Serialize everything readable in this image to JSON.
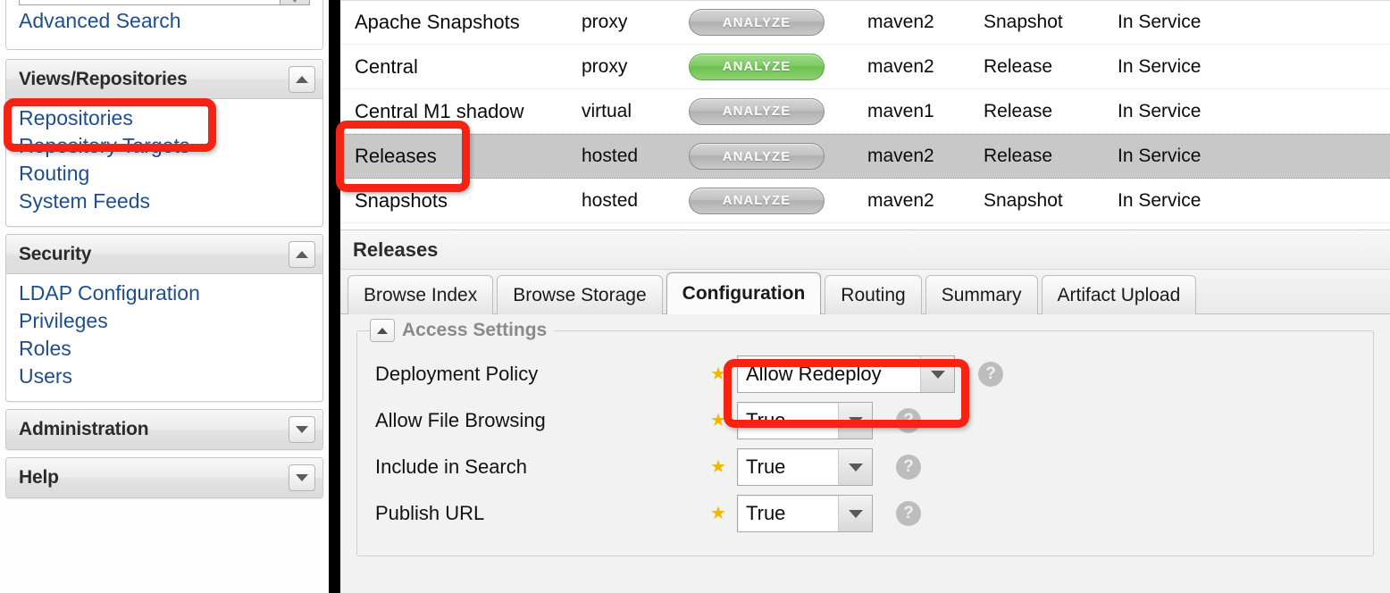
{
  "sidebar": {
    "search": {
      "value": "",
      "placeholder": "",
      "go_icon": "chevron-down-icon",
      "advanced_search_label": "Advanced Search"
    },
    "panels": [
      {
        "title": "Views/Repositories",
        "collapse_icon": "triangle-up-icon",
        "expanded": true,
        "items": [
          {
            "label": "Repositories",
            "selected": true
          },
          {
            "label": "Repository Targets",
            "selected": false
          },
          {
            "label": "Routing",
            "selected": false
          },
          {
            "label": "System Feeds",
            "selected": false
          }
        ]
      },
      {
        "title": "Security",
        "collapse_icon": "triangle-up-icon",
        "expanded": true,
        "items": [
          {
            "label": "LDAP Configuration",
            "selected": false
          },
          {
            "label": "Privileges",
            "selected": false
          },
          {
            "label": "Roles",
            "selected": false
          },
          {
            "label": "Users",
            "selected": false
          }
        ]
      },
      {
        "title": "Administration",
        "collapse_icon": "triangle-down-icon",
        "expanded": false,
        "items": []
      },
      {
        "title": "Help",
        "collapse_icon": "triangle-down-icon",
        "expanded": false,
        "items": []
      }
    ]
  },
  "repo_grid": {
    "rows": [
      {
        "name": "Apache Snapshots",
        "type": "proxy",
        "health_label": "ANALYZE",
        "health_state": "grey",
        "format": "maven2",
        "policy": "Snapshot",
        "status": "In Service",
        "selected": false
      },
      {
        "name": "Central",
        "type": "proxy",
        "health_label": "ANALYZE",
        "health_state": "green",
        "format": "maven2",
        "policy": "Release",
        "status": "In Service",
        "selected": false
      },
      {
        "name": "Central M1 shadow",
        "type": "virtual",
        "health_label": "ANALYZE",
        "health_state": "grey",
        "format": "maven1",
        "policy": "Release",
        "status": "In Service",
        "selected": false
      },
      {
        "name": "Releases",
        "type": "hosted",
        "health_label": "ANALYZE",
        "health_state": "grey",
        "format": "maven2",
        "policy": "Release",
        "status": "In Service",
        "selected": true
      },
      {
        "name": "Snapshots",
        "type": "hosted",
        "health_label": "ANALYZE",
        "health_state": "grey",
        "format": "maven2",
        "policy": "Snapshot",
        "status": "In Service",
        "selected": false
      }
    ]
  },
  "detail": {
    "title": "Releases",
    "tabs": [
      {
        "label": "Browse Index",
        "active": false
      },
      {
        "label": "Browse Storage",
        "active": false
      },
      {
        "label": "Configuration",
        "active": true
      },
      {
        "label": "Routing",
        "active": false
      },
      {
        "label": "Summary",
        "active": false
      },
      {
        "label": "Artifact Upload",
        "active": false
      }
    ],
    "fieldset": {
      "legend": "Access Settings",
      "collapse_icon": "triangle-up-icon",
      "fields": [
        {
          "label": "Deployment Policy",
          "value": "Allow Redeploy",
          "required_icon": "star-icon",
          "help_icon": "question-mark-icon",
          "width": "wide"
        },
        {
          "label": "Allow File Browsing",
          "value": "True",
          "required_icon": "star-icon",
          "help_icon": "question-mark-icon",
          "width": "narrow"
        },
        {
          "label": "Include in Search",
          "value": "True",
          "required_icon": "star-icon",
          "help_icon": "question-mark-icon",
          "width": "narrow"
        },
        {
          "label": "Publish URL",
          "value": "True",
          "required_icon": "star-icon",
          "help_icon": "question-mark-icon",
          "width": "narrow"
        }
      ]
    }
  },
  "annotations": {
    "color": "#f52314",
    "boxes": [
      {
        "target": "sidebar-item-repositories"
      },
      {
        "target": "repo-row-releases"
      },
      {
        "target": "deployment-policy-select"
      }
    ]
  },
  "glyphs": {
    "star": "★",
    "question": "?"
  }
}
